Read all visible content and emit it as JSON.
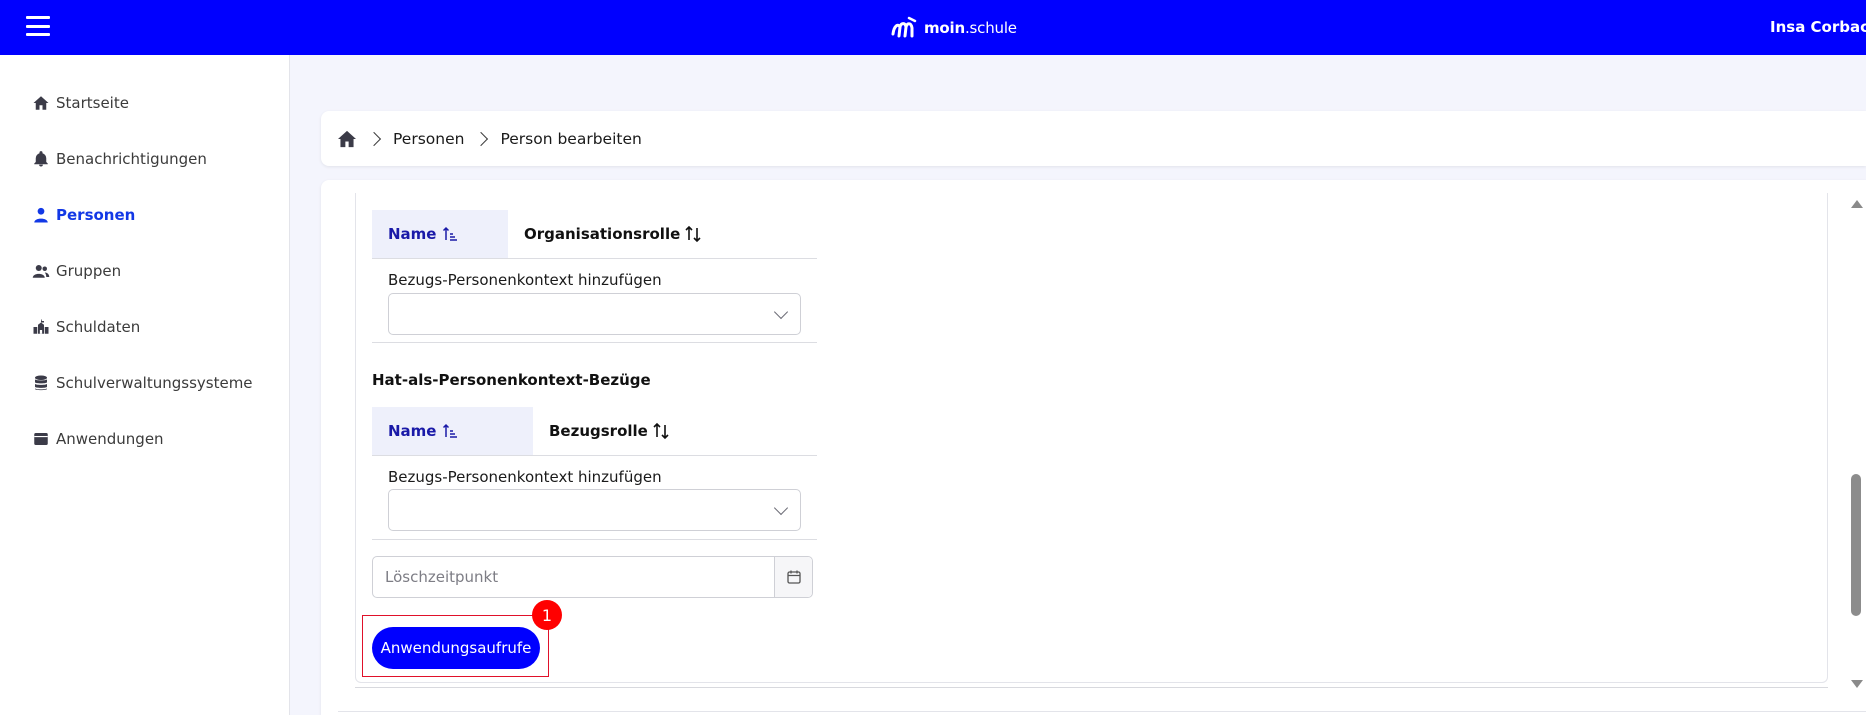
{
  "header": {
    "logo_bold": "moin",
    "logo_rest": ".schule",
    "user_name": "Insa Corbach",
    "brand_color": "#0000ff"
  },
  "sidebar": {
    "items": [
      {
        "label": "Startseite",
        "icon": "home-icon",
        "active": false
      },
      {
        "label": "Benachrichtigungen",
        "icon": "bell-icon",
        "active": false
      },
      {
        "label": "Personen",
        "icon": "person-icon",
        "active": true
      },
      {
        "label": "Gruppen",
        "icon": "group-icon",
        "active": false
      },
      {
        "label": "Schuldaten",
        "icon": "school-icon",
        "active": false
      },
      {
        "label": "Schulverwaltungssysteme",
        "icon": "database-icon",
        "active": false
      },
      {
        "label": "Anwendungen",
        "icon": "app-icon",
        "active": false
      }
    ],
    "active_color": "#1238e6"
  },
  "breadcrumb": {
    "items": [
      "Personen",
      "Person bearbeiten"
    ]
  },
  "table1": {
    "col_name": "Name",
    "col_role": "Organisationsrolle",
    "add_label": "Bezugs-Personenkontext hinzufügen",
    "select_value": ""
  },
  "section2": {
    "title": "Hat-als-Personenkontext-Bezüge",
    "col_name": "Name",
    "col_role": "Bezugsrolle",
    "add_label": "Bezugs-Personenkontext hinzufügen",
    "select_value": ""
  },
  "deletion": {
    "placeholder": "Löschzeitpunkt",
    "value": ""
  },
  "action": {
    "button_label": "Anwendungsaufrufe",
    "badge": "1",
    "highlight_color": "#e0112a"
  }
}
